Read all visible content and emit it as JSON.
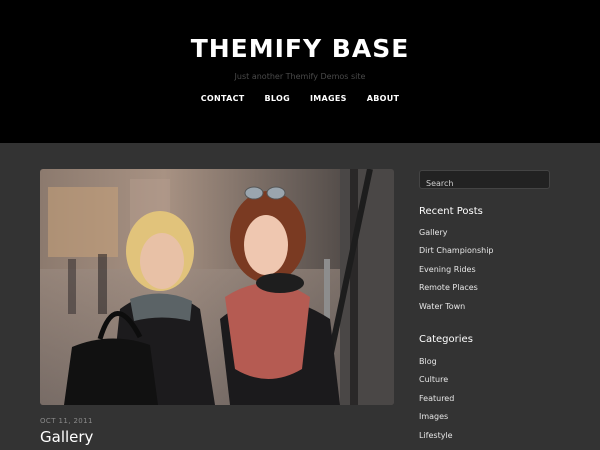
{
  "header": {
    "site_title": "THEMIFY BASE",
    "tagline": "Just another Themify Demos site",
    "nav": [
      {
        "label": "CONTACT"
      },
      {
        "label": "BLOG"
      },
      {
        "label": "IMAGES"
      },
      {
        "label": "ABOUT"
      }
    ]
  },
  "post": {
    "date": "OCT 11, 2011",
    "title": "Gallery"
  },
  "sidebar": {
    "search": {
      "placeholder": "Search"
    },
    "recent_posts": {
      "title": "Recent Posts",
      "items": [
        {
          "label": "Gallery"
        },
        {
          "label": "Dirt Championship"
        },
        {
          "label": "Evening Rides"
        },
        {
          "label": "Remote Places"
        },
        {
          "label": "Water Town"
        }
      ]
    },
    "categories": {
      "title": "Categories",
      "items": [
        {
          "label": "Blog"
        },
        {
          "label": "Culture"
        },
        {
          "label": "Featured"
        },
        {
          "label": "Images"
        },
        {
          "label": "Lifestyle"
        }
      ]
    }
  },
  "colors": {
    "header_bg": "#000000",
    "page_bg": "#333333",
    "text": "#ffffff",
    "muted": "#8a8a8a"
  }
}
